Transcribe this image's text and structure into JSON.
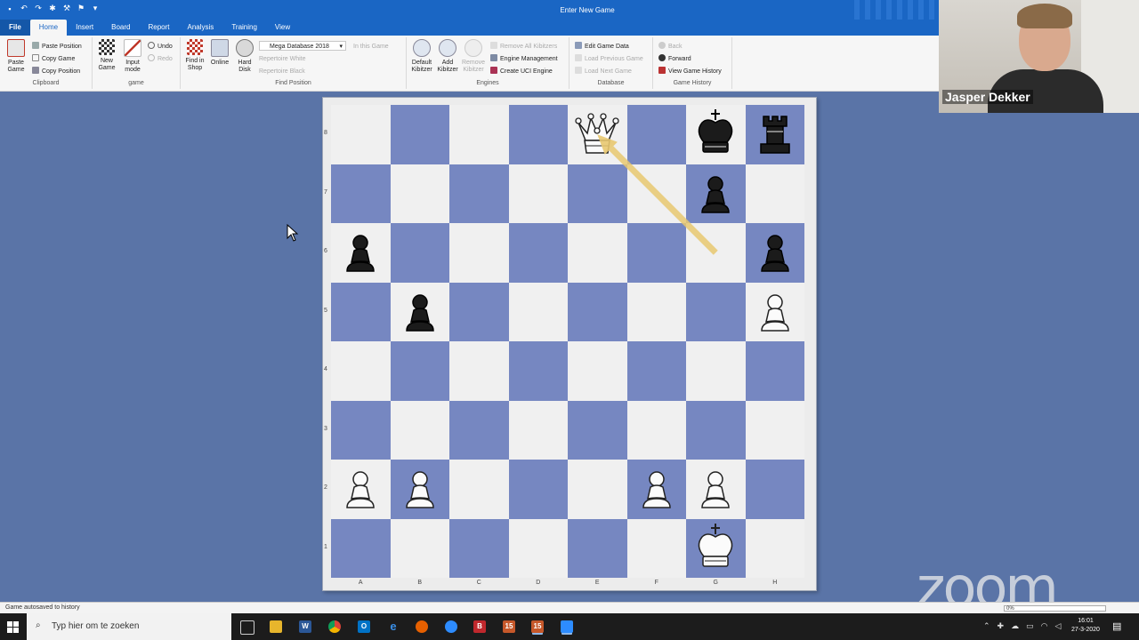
{
  "window": {
    "title": "Enter New Game"
  },
  "quick_access": [
    "save-icon",
    "undo-icon",
    "redo-icon",
    "settings-icon",
    "tools-icon",
    "flag-icon",
    "customize-icon"
  ],
  "tabs": [
    {
      "label": "File"
    },
    {
      "label": "Home"
    },
    {
      "label": "Insert"
    },
    {
      "label": "Board"
    },
    {
      "label": "Report"
    },
    {
      "label": "Analysis"
    },
    {
      "label": "Training"
    },
    {
      "label": "View"
    }
  ],
  "ribbon": {
    "clipboard": {
      "paste_game": "Paste Game",
      "paste_position": "Paste Position",
      "copy_game": "Copy Game",
      "copy_position": "Copy Position",
      "label": "Clipboard"
    },
    "game": {
      "new_game": "New Game",
      "input_mode": "Input mode",
      "undo": "Undo",
      "redo": "Redo",
      "label": "game"
    },
    "find_position": {
      "find_in_shop": "Find in Shop",
      "online": "Online",
      "hard_disk": "Hard Disk",
      "database": "Mega Database 2018",
      "in_this_game": "In this Game",
      "repertoire_white": "Repertoire White",
      "repertoire_black": "Repertoire Black",
      "label": "Find Position"
    },
    "engines": {
      "default_kibitzer": "Default Kibitzer",
      "add_kibitzer": "Add Kibitzer",
      "remove_kibitzer": "Remove Kibitzer",
      "remove_all": "Remove All Kibitzers",
      "engine_management": "Engine Management",
      "create_uci": "Create UCI Engine",
      "label": "Engines"
    },
    "database": {
      "edit_game_data": "Edit Game Data",
      "load_previous": "Load Previous Game",
      "load_next": "Load Next Game",
      "label": "Database"
    },
    "history": {
      "back": "Back",
      "forward": "Forward",
      "view_history": "View Game History",
      "label": "Game History"
    }
  },
  "webcam": {
    "name": "Jasper Dekker"
  },
  "board": {
    "files": [
      "A",
      "B",
      "C",
      "D",
      "E",
      "F",
      "G",
      "H"
    ],
    "ranks": [
      "8",
      "7",
      "6",
      "5",
      "4",
      "3",
      "2",
      "1"
    ],
    "pieces": [
      {
        "square": "e8",
        "piece": "queen",
        "color": "white"
      },
      {
        "square": "g8",
        "piece": "king",
        "color": "black"
      },
      {
        "square": "h8",
        "piece": "rook",
        "color": "black"
      },
      {
        "square": "g7",
        "piece": "pawn",
        "color": "black"
      },
      {
        "square": "a6",
        "piece": "pawn",
        "color": "black"
      },
      {
        "square": "h6",
        "piece": "pawn",
        "color": "black"
      },
      {
        "square": "b5",
        "piece": "pawn",
        "color": "black"
      },
      {
        "square": "h5",
        "piece": "pawn",
        "color": "white"
      },
      {
        "square": "a2",
        "piece": "pawn",
        "color": "white"
      },
      {
        "square": "b2",
        "piece": "pawn",
        "color": "white"
      },
      {
        "square": "f2",
        "piece": "pawn",
        "color": "white"
      },
      {
        "square": "g2",
        "piece": "pawn",
        "color": "white"
      },
      {
        "square": "g1",
        "piece": "king",
        "color": "white"
      }
    ],
    "arrow": {
      "from": "g6",
      "to": "e8",
      "color": "#e8c870"
    },
    "light_color": "#f0f0f0",
    "dark_color": "#7687c1"
  },
  "status": {
    "text": "Game autosaved to history",
    "progress": "0%"
  },
  "overlay": {
    "zoom": "zoom"
  },
  "taskbar": {
    "search_placeholder": "Typ hier om te zoeken",
    "apps": [
      "task-view-icon",
      "file-explorer-icon",
      "word-icon",
      "chrome-icon",
      "outlook-icon",
      "edge-icon",
      "firefox-icon",
      "vpn-icon",
      "b-app-icon",
      "chessbase-icon",
      "chessbase-active-icon",
      "zoom-icon"
    ],
    "time": "16:01",
    "date": "27-3-2020"
  }
}
